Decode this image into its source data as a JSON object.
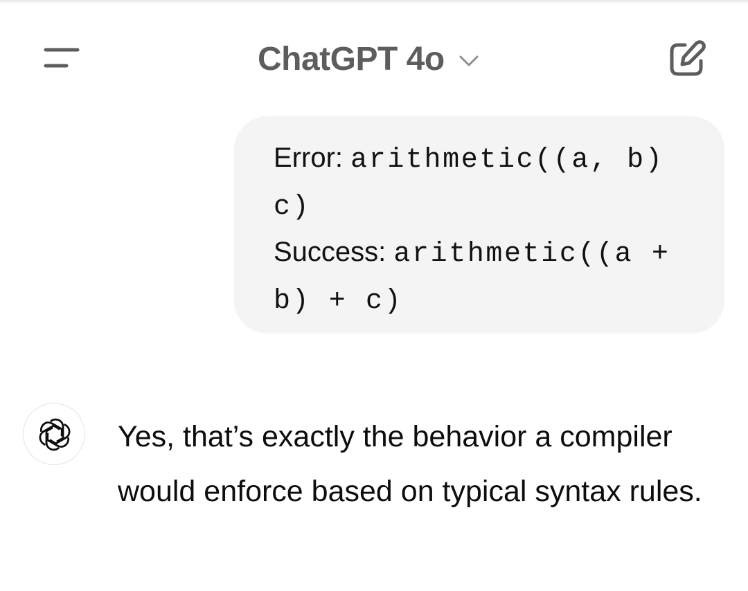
{
  "header": {
    "menu_icon": "menu-icon",
    "title": "ChatGPT 4o",
    "model_dropdown_icon": "chevron-down-icon",
    "new_chat_icon": "new-chat-icon"
  },
  "conversation": {
    "user_message": {
      "lines": [
        {
          "label": "Error: ",
          "code": "arithmetic((a, b)"
        },
        {
          "label": "",
          "code": "c)"
        },
        {
          "label": "Success: ",
          "code": "arithmetic((a +"
        },
        {
          "label": "",
          "code": "b) + c)"
        }
      ]
    },
    "assistant_message": {
      "avatar_icon": "openai-logo-icon",
      "text": "Yes, that’s exactly the behavior a compiler would enforce based on typical syntax rules."
    }
  },
  "colors": {
    "background": "#ffffff",
    "user_bubble": "#f4f4f4",
    "header_text": "#5d5d5d",
    "icon": "#5d5d5d",
    "text": "#0d0d0d"
  }
}
